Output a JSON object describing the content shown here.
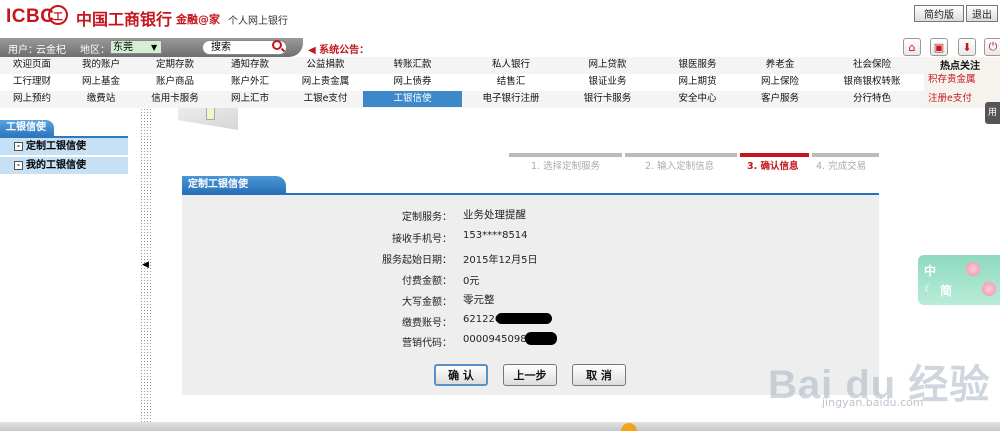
{
  "header": {
    "logo_en": "ICBC",
    "logo_mark": "工",
    "logo_cn": "中国工商银行",
    "slogan": "金融@家",
    "subtitle": "个人网上银行",
    "btn_simple": "简约版",
    "btn_exit": "退出"
  },
  "userbar": {
    "user_label": "用户：",
    "user_name": "云金杞",
    "region_label": "地区：",
    "region_value": "东莞",
    "search_placeholder": "搜索",
    "notice": "系统公告："
  },
  "nav": {
    "row1": [
      "欢迎页面",
      "我的账户",
      "定期存款",
      "通知存款",
      "公益捐款",
      "转账汇款",
      "私人银行",
      "网上贷款",
      "银医服务",
      "养老金",
      "社会保险"
    ],
    "row2": [
      "工行理财",
      "网上基金",
      "账户商品",
      "账户外汇",
      "网上贵金属",
      "网上债券",
      "结售汇",
      "银证业务",
      "网上期货",
      "网上保险",
      "银商银权转账"
    ],
    "row3": [
      "网上预约",
      "缴费站",
      "信用卡服务",
      "网上汇市",
      "工银e支付",
      "工银信使",
      "电子银行注册",
      "银行卡服务",
      "安全中心",
      "客户服务",
      "分行特色"
    ],
    "active": "工银信使"
  },
  "hot": {
    "title": "热点关注",
    "items": [
      "积存贵金属",
      "注册e支付"
    ]
  },
  "sidebar": {
    "title": "工银信使",
    "items": [
      "定制工银信使",
      "我的工银信使"
    ]
  },
  "steps": [
    {
      "label": "1. 选择定制服务",
      "current": false
    },
    {
      "label": "2. 输入定制信息",
      "current": false
    },
    {
      "label": "3. 确认信息",
      "current": true
    },
    {
      "label": "4. 完成交易",
      "current": false
    }
  ],
  "section_title": "定制工银信使",
  "form": [
    {
      "label": "定制服务：",
      "value": "业务处理提醒"
    },
    {
      "label": "接收手机号：",
      "value": "153****8514"
    },
    {
      "label": "服务起始日期：",
      "value": "2015年12月5日"
    },
    {
      "label": "付费金额：",
      "value": "0元"
    },
    {
      "label": "大写金额：",
      "value": "零元整"
    },
    {
      "label": "缴费账号：",
      "value": "621226"
    },
    {
      "label": "营销代码：",
      "value": "0000945098"
    }
  ],
  "buttons": {
    "confirm": "确 认",
    "prev": "上一步",
    "cancel": "取 消"
  },
  "side_tab": "用",
  "lang": {
    "zh": "中",
    "jian": "简"
  },
  "watermark": {
    "main": "Bai du 经验",
    "sub": "jingyan.baidu.com"
  },
  "colors": {
    "brand_red": "#c4161c",
    "nav_active": "#3d88c8",
    "sidebar_blue": "#2f77be"
  }
}
